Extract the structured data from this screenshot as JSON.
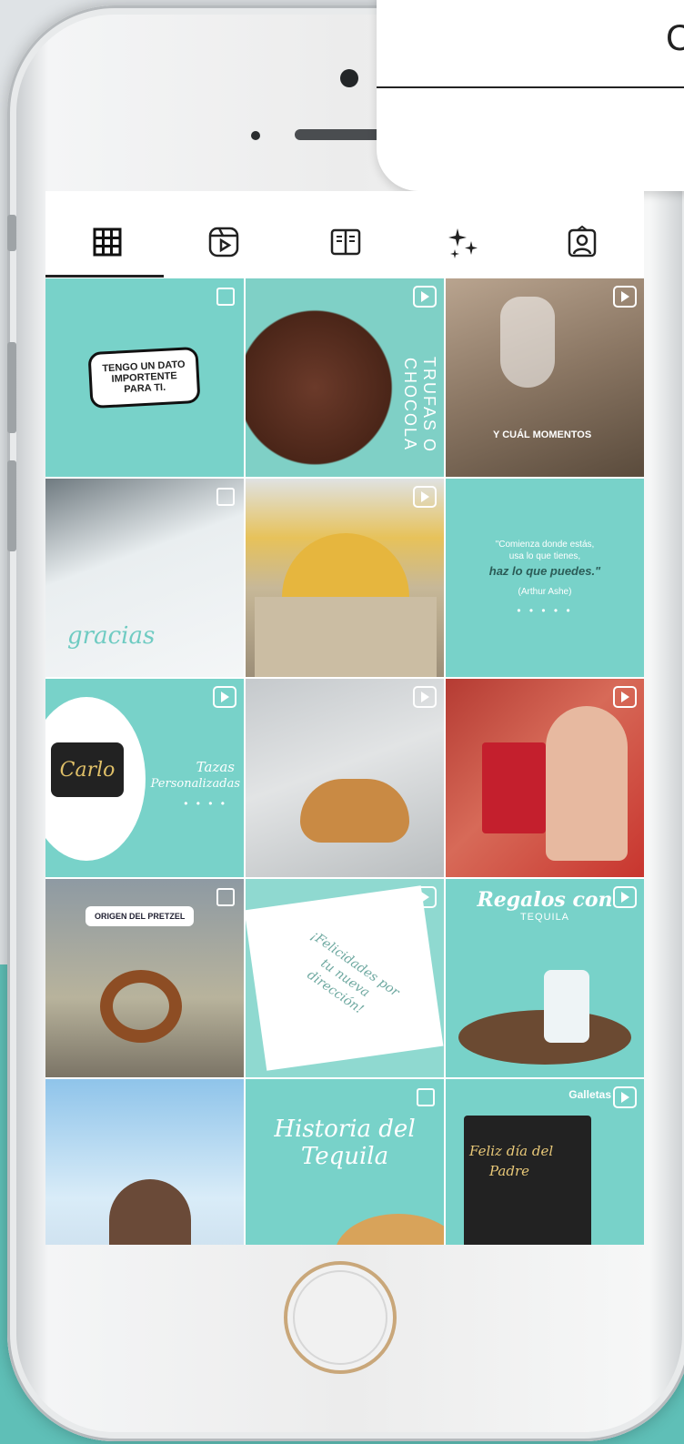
{
  "card": {
    "glyph": "C"
  },
  "tabs": [
    {
      "name": "posts-grid-icon",
      "symbol": "▦"
    },
    {
      "name": "reels-icon",
      "symbol": "▷"
    },
    {
      "name": "guides-icon",
      "symbol": "📖"
    },
    {
      "name": "effects-sparkle-icon",
      "symbol": "✦"
    },
    {
      "name": "tagged-icon",
      "symbol": "👤"
    }
  ],
  "posts": {
    "p1": {
      "line1": "TENGO UN DATO",
      "line2": "IMPORTENTE",
      "line3": "PARA TI."
    },
    "p2": {
      "text": "TRUFAS O CHOCOLA"
    },
    "p3": {
      "text": "Y CUÁL MOMENTOS"
    },
    "p4": {
      "text": "gracias"
    },
    "p6": {
      "quote1": "\"Comienza donde estás,",
      "quote2": "usa lo que tienes,",
      "quote3": "haz lo que puedes.\"",
      "author": "(Arthur Ashe)",
      "dots": "• • • • •"
    },
    "p7": {
      "word": "Carlo",
      "title1": "Tazas",
      "title2": "Personalizadas",
      "dots": "• • • •"
    },
    "p10": {
      "title": "ORIGEN DEL PRETZEL"
    },
    "p11": {
      "line1": "¡Felicidades por",
      "line2": "tu nueva",
      "line3": "dirección!"
    },
    "p12": {
      "title": "Regalos con",
      "sub": "TEQUILA"
    },
    "p14": {
      "line1": "Historia del",
      "line2": "Tequila"
    },
    "p15": {
      "top": "Galletas",
      "line1": "Feliz día del",
      "line2": "Padre"
    }
  }
}
